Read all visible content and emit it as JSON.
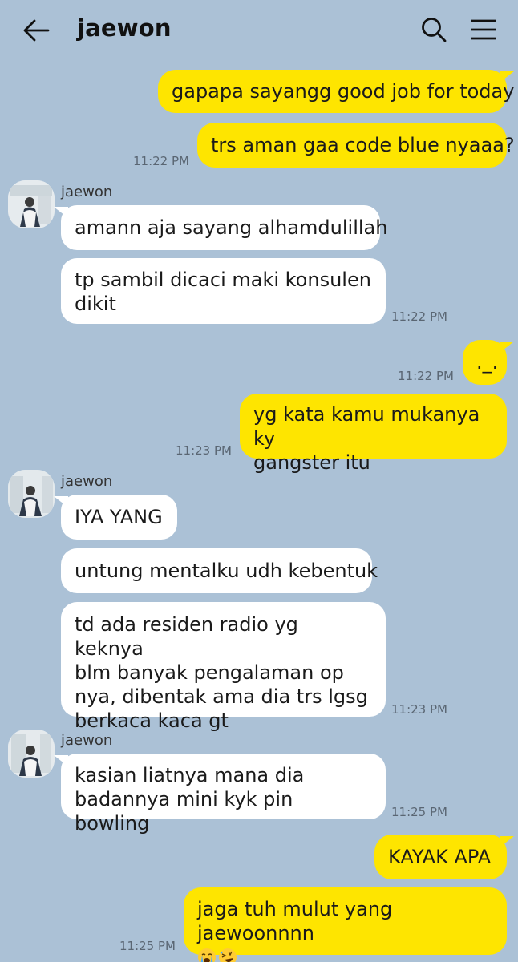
{
  "header": {
    "title": "jaewon"
  },
  "messages": {
    "m1": {
      "text": "gapapa sayangg good job for today"
    },
    "m2": {
      "text": "trs aman gaa code blue nyaaa?",
      "time": "11:22 PM"
    },
    "g1": {
      "sender": "jaewon"
    },
    "m3": {
      "text": "amann aja sayang alhamdulillah"
    },
    "m4": {
      "line1": "tp sambil dicaci maki konsulen",
      "line2": "dikit",
      "time": "11:22 PM"
    },
    "m5": {
      "text": "._.",
      "time": "11:22 PM"
    },
    "m6": {
      "line1": "yg kata kamu mukanya ky",
      "line2": "gangster itu",
      "time": "11:23 PM"
    },
    "g2": {
      "sender": "jaewon"
    },
    "m7": {
      "text": "IYA YANG"
    },
    "m8": {
      "text": "untung mentalku udh kebentuk"
    },
    "m9": {
      "line1": "td ada residen radio yg keknya",
      "line2": "blm banyak pengalaman op",
      "line3": "nya, dibentak ama dia trs lgsg",
      "line4": "berkaca kaca gt",
      "time": "11:23 PM"
    },
    "g3": {
      "sender": "jaewon"
    },
    "m10": {
      "line1": "kasian liatnya mana dia",
      "line2": "badannya mini kyk pin bowling",
      "time": "11:25 PM"
    },
    "m11": {
      "text": "KAYAK APA"
    },
    "m12": {
      "line1": "jaga tuh mulut yang jaewoonnnn",
      "emojis": [
        "loudly-crying-face",
        "rolling-on-floor-laughing"
      ],
      "time": "11:25 PM"
    }
  },
  "colors": {
    "background": "#abc1d6",
    "outgoing_bubble": "#fee500",
    "incoming_bubble": "#ffffff"
  }
}
